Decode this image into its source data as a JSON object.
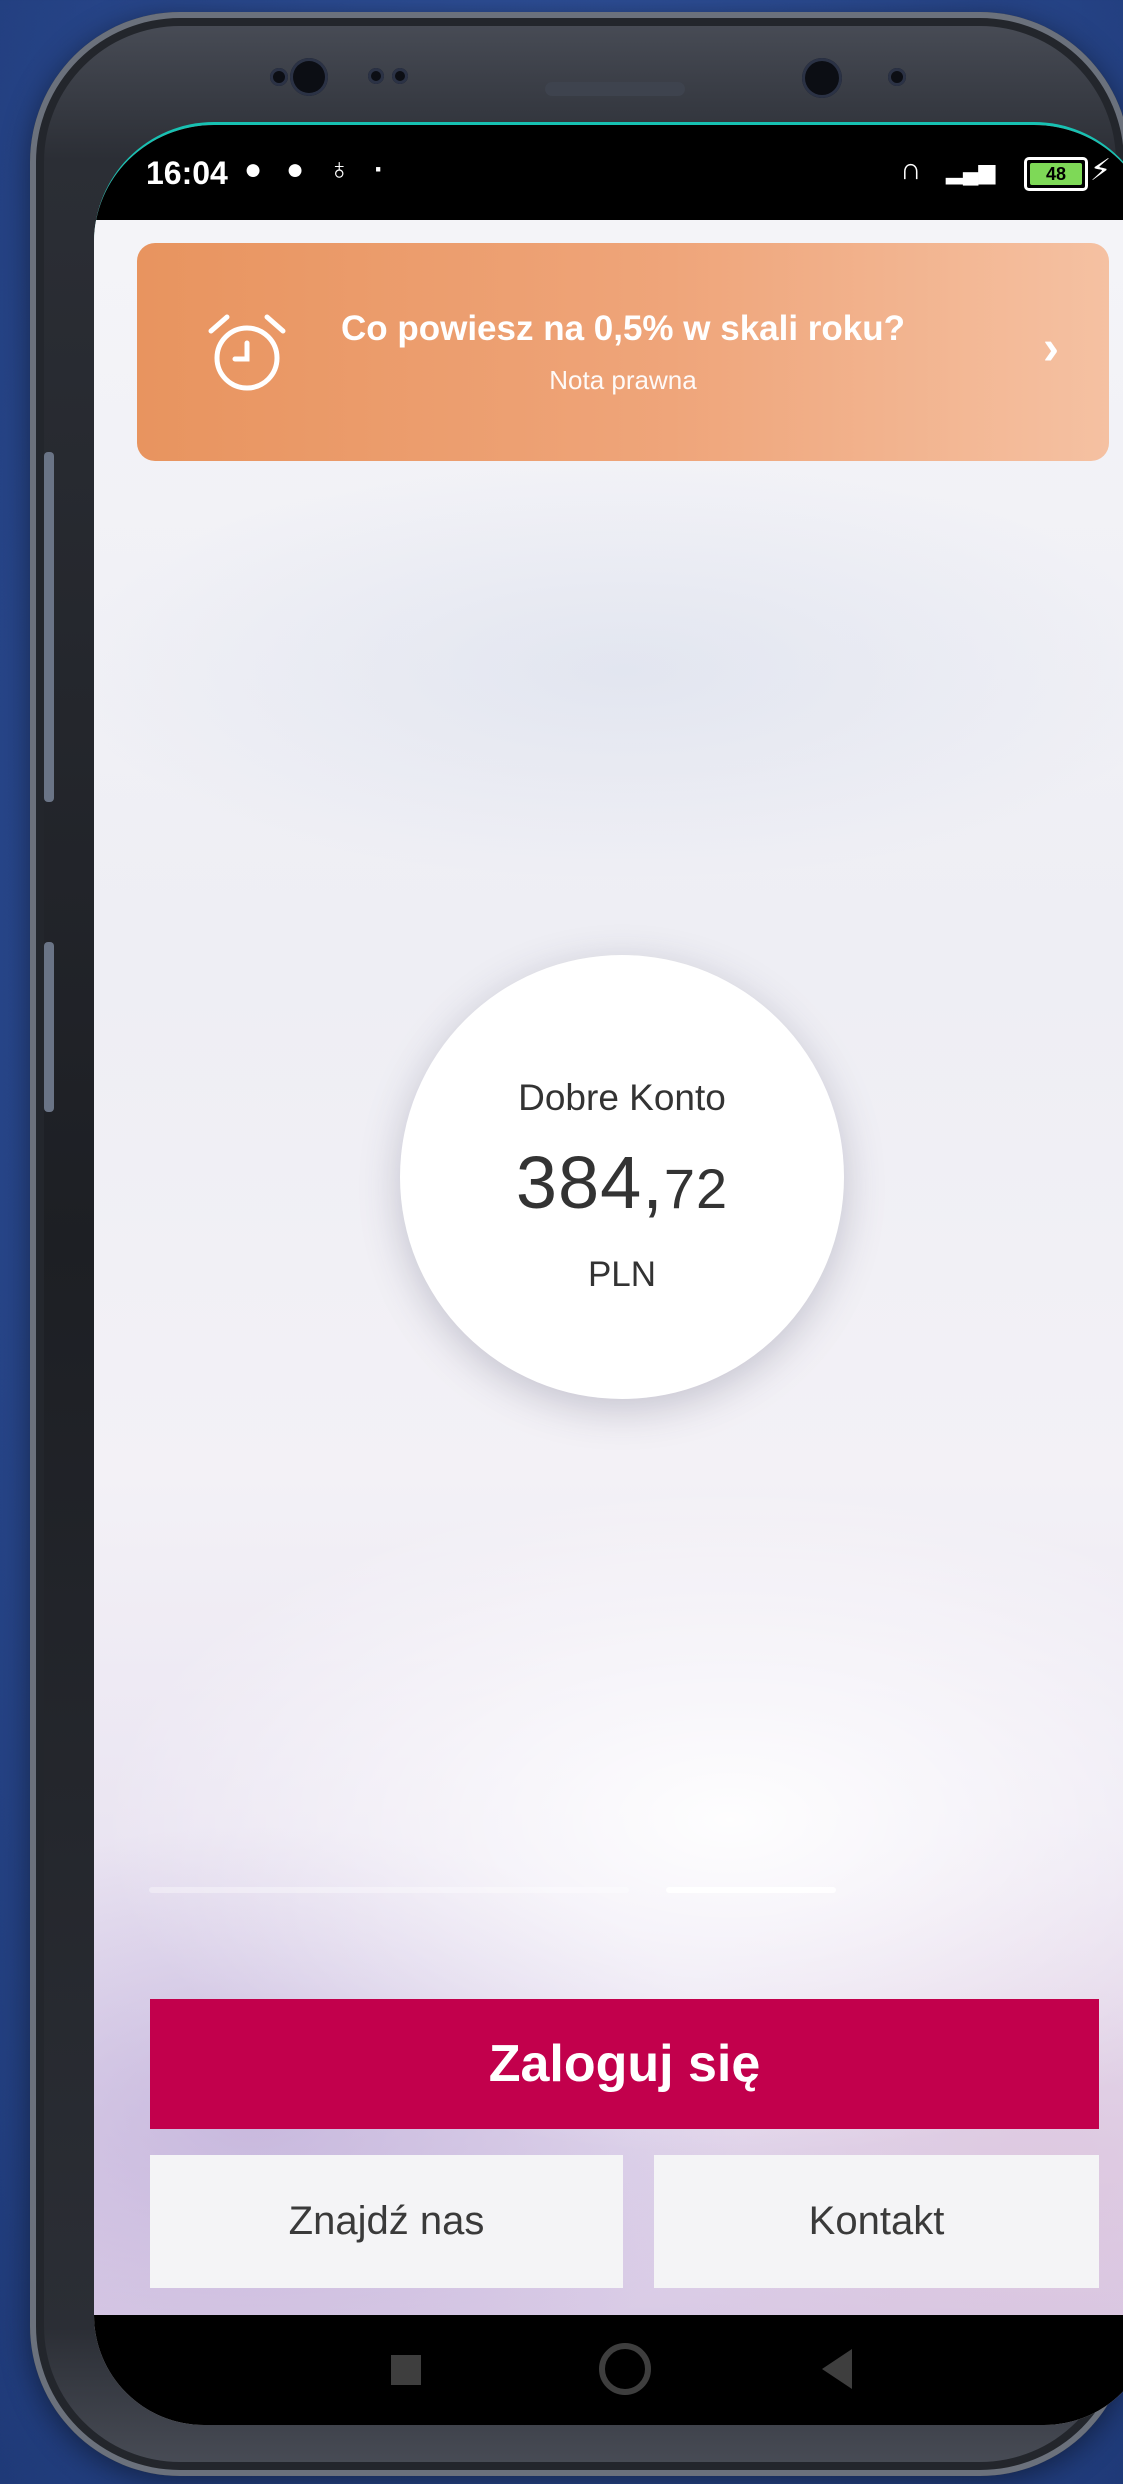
{
  "status_bar": {
    "time": "16:04",
    "battery_level": "48"
  },
  "promo_banner": {
    "title": "Co powiesz na 0,5% w skali roku?",
    "subtitle": "Nota prawna",
    "icon": "alarm-clock-icon",
    "chevron": "›"
  },
  "account": {
    "name": "Dobre Konto",
    "amount_int": "384,",
    "amount_dec": "72",
    "currency": "PLN"
  },
  "actions": {
    "login_label": "Zaloguj się",
    "find_label": "Znajdź nas",
    "contact_label": "Kontakt"
  },
  "colors": {
    "brand_primary": "#c2004c",
    "banner_orange": "#e8945f",
    "accent_teal": "#17c1b2"
  },
  "pager": {
    "count": 2,
    "active_index": 1
  }
}
